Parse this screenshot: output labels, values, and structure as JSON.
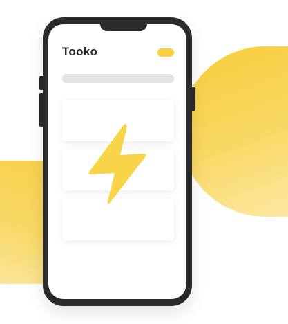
{
  "app": {
    "title": "Tooko"
  },
  "header": {
    "menu_icon": "menu-pill-icon"
  },
  "cards": [
    {
      "id": "card-1"
    },
    {
      "id": "card-2"
    },
    {
      "id": "card-3"
    }
  ],
  "overlay": {
    "icon": "lightning-bolt-icon"
  },
  "colors": {
    "accent": "#F8CF3E",
    "phone_frame": "#2B2B2B",
    "screen": "#FFFFFF",
    "placeholder": "#E3E3E3"
  }
}
